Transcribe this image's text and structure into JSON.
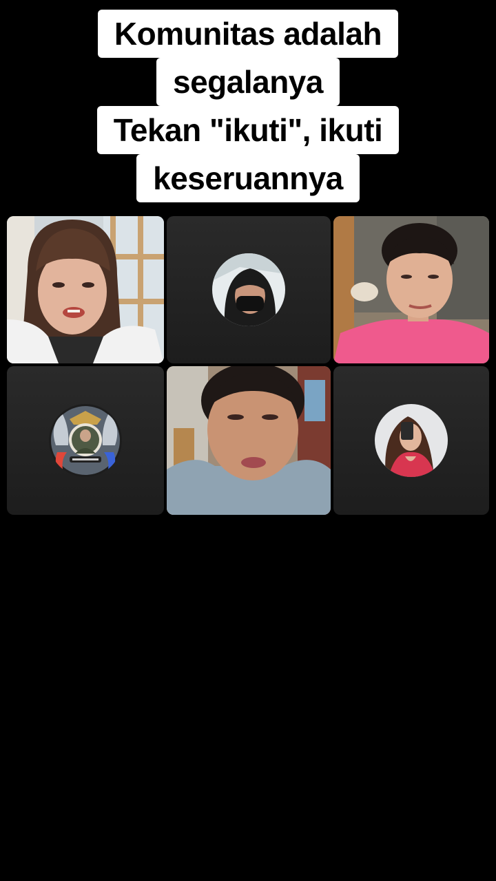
{
  "caption": {
    "lines": [
      "Komunitas adalah",
      "segalanya",
      "Tekan \"ikuti\", ikuti",
      "keseruannya"
    ]
  },
  "participants": [
    {
      "type": "video"
    },
    {
      "type": "avatar",
      "icon": "masked-person-avatar"
    },
    {
      "type": "video"
    },
    {
      "type": "avatar",
      "icon": "emblem-avatar"
    },
    {
      "type": "video"
    },
    {
      "type": "avatar",
      "icon": "selfie-avatar"
    }
  ],
  "colors": {
    "background": "#000000",
    "caption_bg": "#ffffff",
    "caption_text": "#000000",
    "tile_bg": "#232323"
  }
}
